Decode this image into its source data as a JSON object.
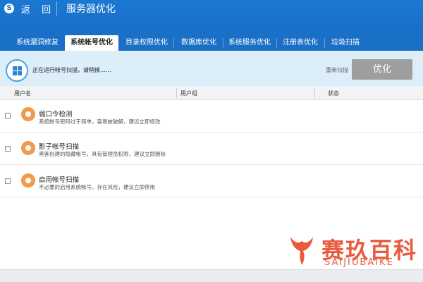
{
  "titlebar": {
    "logo": "S",
    "back_label": "返 回",
    "title": "服务器优化"
  },
  "tabs": [
    {
      "label": "系统漏洞修复"
    },
    {
      "label": "系统帐号优化",
      "active": true
    },
    {
      "label": "目录权限优化"
    },
    {
      "label": "数据库优化"
    },
    {
      "label": "系统服务优化"
    },
    {
      "label": "注册表优化"
    },
    {
      "label": "垃圾扫描"
    }
  ],
  "status": {
    "scan_text": "正在进行帐号扫描，请稍候……",
    "rescan_label": "重新扫描",
    "optimize_label": "优化",
    "icon": "windows-icon"
  },
  "table": {
    "headers": [
      "用户名",
      "用户组",
      "状态"
    ],
    "rows": [
      {
        "title": "弱口令检测",
        "description": "系统帐号密码过于简单，容易被破解，建议立即修改",
        "icon": "weak-password-icon"
      },
      {
        "title": "影子帐号扫描",
        "description": "黑客创建的隐藏帐号，具有管理员权限，建议立即删除",
        "icon": "shadow-account-icon"
      },
      {
        "title": "启用帐号扫描",
        "description": "不必要的启用系统帐号，存在风险，建议立即停用",
        "icon": "enabled-account-icon"
      }
    ]
  },
  "watermark": {
    "main": "赛玖百科",
    "sub": "SAIJIUBAIKE"
  },
  "colors": {
    "titlebar": "#1a6fc7",
    "status_bg": "#dbeef9",
    "accent_orange": "#f19a4c",
    "watermark": "#ea5a3c"
  }
}
